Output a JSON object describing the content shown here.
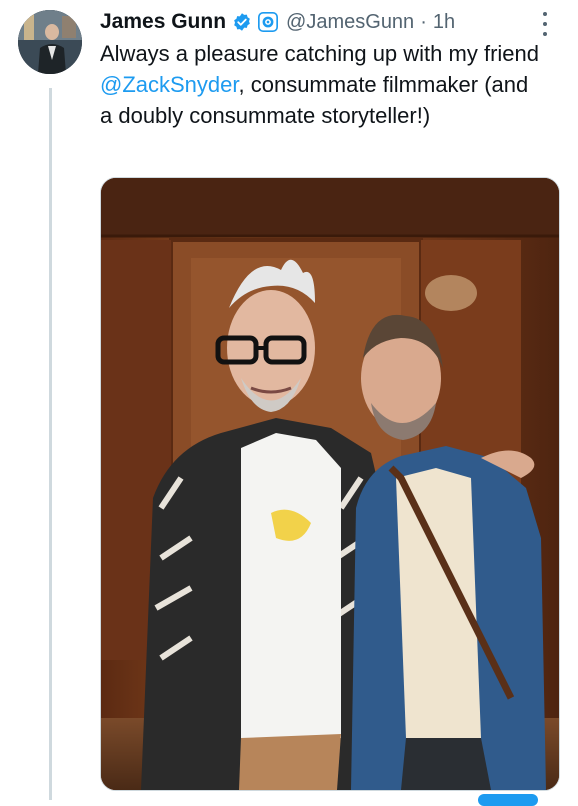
{
  "tweet": {
    "author_name": "James Gunn",
    "handle": "@JamesGunn",
    "separator": "·",
    "time": "1h",
    "text_before": "Always a pleasure catching up with my friend ",
    "mention": "@ZackSnyder",
    "text_after": ", consummate filmmaker (and a doubly consummate storyteller!)",
    "verified_color": "#1d9bf0",
    "mention_color": "#1d9bf0"
  },
  "icons": {
    "verified": "verified-badge-icon",
    "affiliate": "affiliate-badge-icon",
    "more": "more-options-icon"
  }
}
